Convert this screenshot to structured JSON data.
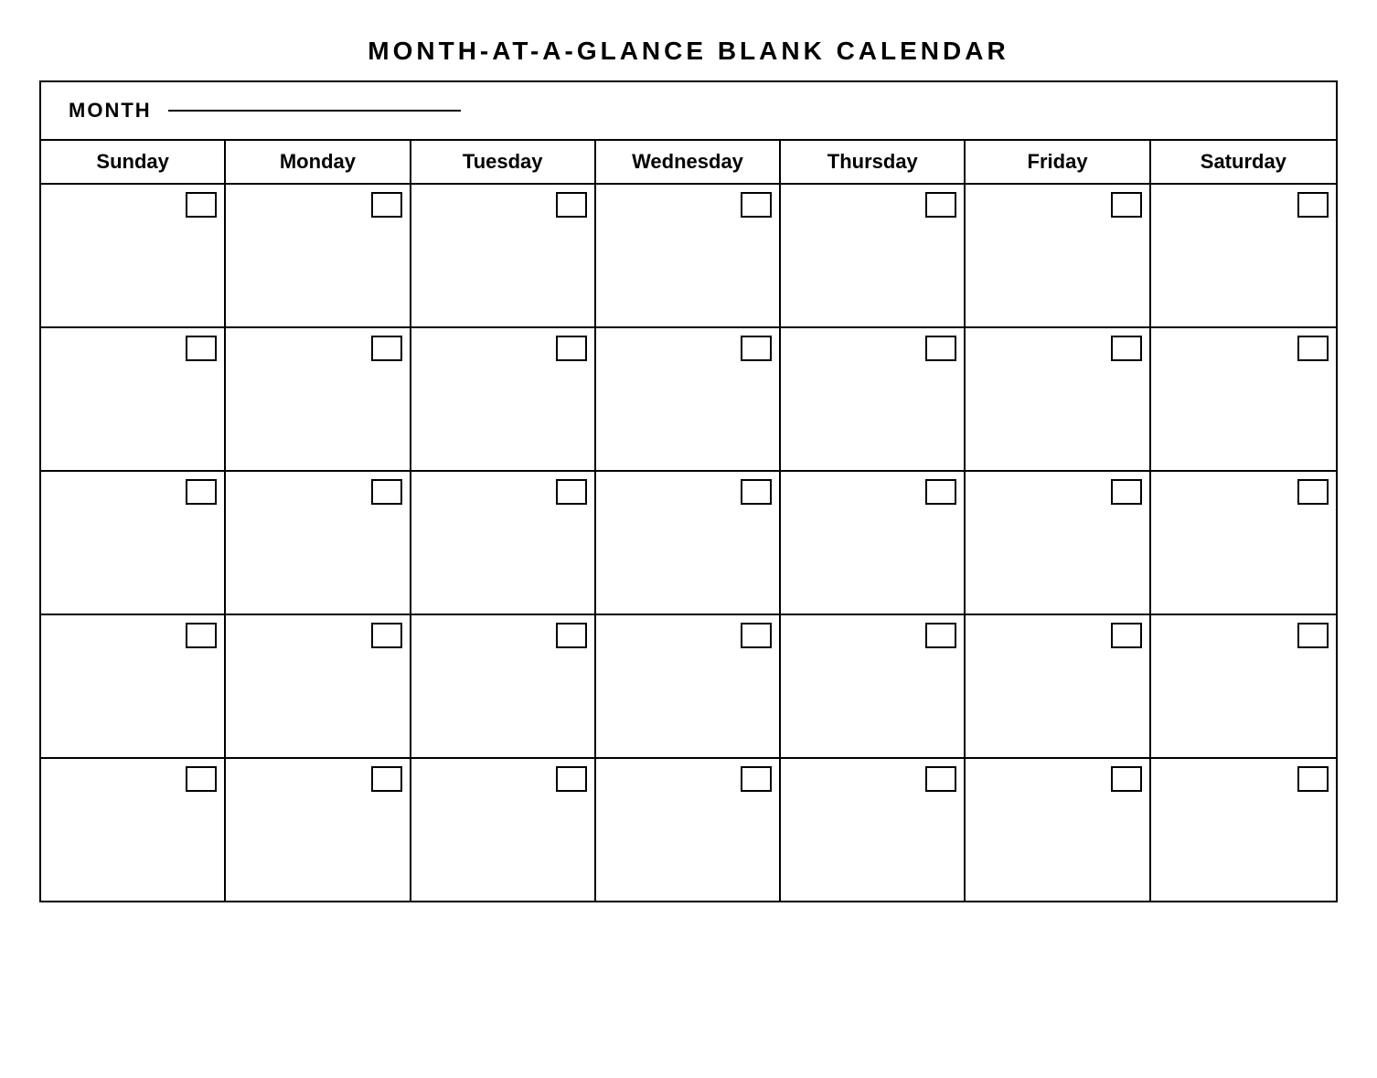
{
  "title": "MONTH-AT-A-GLANCE  BLANK  CALENDAR",
  "month_label": "MONTH",
  "days": [
    {
      "label": "Sunday"
    },
    {
      "label": "Monday"
    },
    {
      "label": "Tuesday"
    },
    {
      "label": "Wednesday"
    },
    {
      "label": "Thursday"
    },
    {
      "label": "Friday"
    },
    {
      "label": "Saturday"
    }
  ],
  "rows": 5
}
